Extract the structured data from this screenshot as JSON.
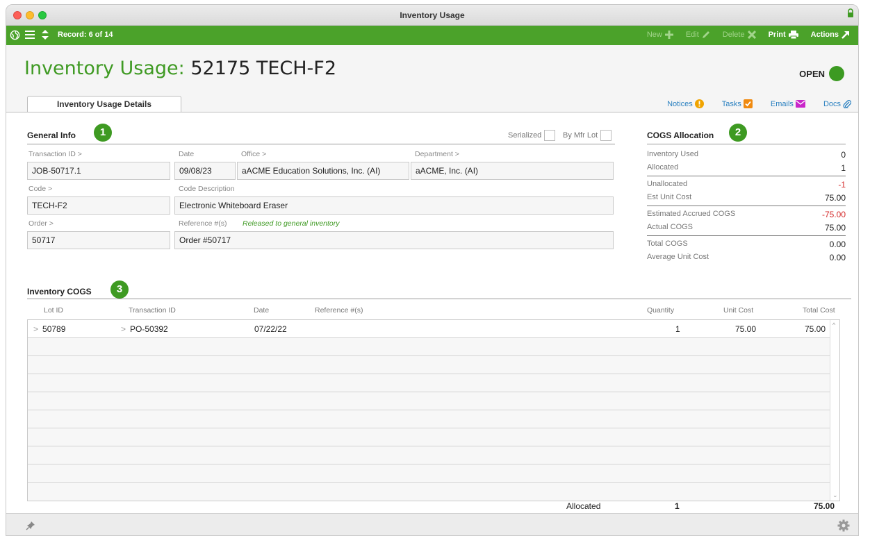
{
  "window": {
    "title": "Inventory Usage"
  },
  "toolbar": {
    "record": "Record: 6 of 14",
    "new": "New",
    "edit": "Edit",
    "delete": "Delete",
    "print": "Print",
    "actions": "Actions"
  },
  "header": {
    "title_label": "Inventory Usage:",
    "title_value": "52175 TECH-F2",
    "status": "OPEN",
    "status_color": "#3c9a22"
  },
  "tab": {
    "label": "Inventory Usage Details"
  },
  "links": {
    "notices": "Notices",
    "tasks": "Tasks",
    "emails": "Emails",
    "docs": "Docs"
  },
  "general_info": {
    "title": "General Info",
    "badge": "1",
    "serialized": "Serialized",
    "by_mfr_lot": "By Mfr Lot",
    "transaction_id_label": "Transaction ID >",
    "transaction_id": "JOB-50717.1",
    "date_label": "Date",
    "date": "09/08/23",
    "office_label": "Office >",
    "office": "aACME Education Solutions, Inc.  (AI)",
    "department_label": "Department >",
    "department": "aACME, Inc.  (AI)",
    "code_label": "Code >",
    "code": "TECH-F2",
    "code_description_label": "Code Description",
    "code_description": "Electronic Whiteboard Eraser",
    "order_label": "Order >",
    "order": "50717",
    "reference_label": "Reference #(s)",
    "reference_note": "Released to general inventory",
    "reference": "Order #50717"
  },
  "cogs_allocation": {
    "title": "COGS Allocation",
    "badge": "2",
    "rows": [
      {
        "label": "Inventory Used",
        "value": "0"
      },
      {
        "label": "Allocated",
        "value": "1"
      },
      {
        "label": "Unallocated",
        "value": "-1"
      },
      {
        "label": "Est Unit Cost",
        "value": "75.00"
      },
      {
        "label": "Estimated Accrued COGS",
        "value": "-75.00"
      },
      {
        "label": "Actual COGS",
        "value": "75.00"
      },
      {
        "label": "Total COGS",
        "value": "0.00"
      },
      {
        "label": "Average Unit Cost",
        "value": "0.00"
      }
    ]
  },
  "inventory_cogs": {
    "title": "Inventory COGS",
    "badge": "3",
    "headers": {
      "lot_id": "Lot ID",
      "transaction_id": "Transaction ID",
      "date": "Date",
      "reference": "Reference #(s)",
      "quantity": "Quantity",
      "unit_cost": "Unit Cost",
      "total_cost": "Total Cost"
    },
    "rows": [
      {
        "lot_id": "50789",
        "transaction_id": "PO-50392",
        "date": "07/22/22",
        "reference": "",
        "quantity": "1",
        "unit_cost": "75.00",
        "total_cost": "75.00"
      }
    ],
    "totals": {
      "label": "Allocated",
      "quantity": "1",
      "total_cost": "75.00"
    }
  },
  "colors": {
    "brand_green": "#4ba22a",
    "negative": "#d42a2a",
    "link": "#2a80c0"
  }
}
